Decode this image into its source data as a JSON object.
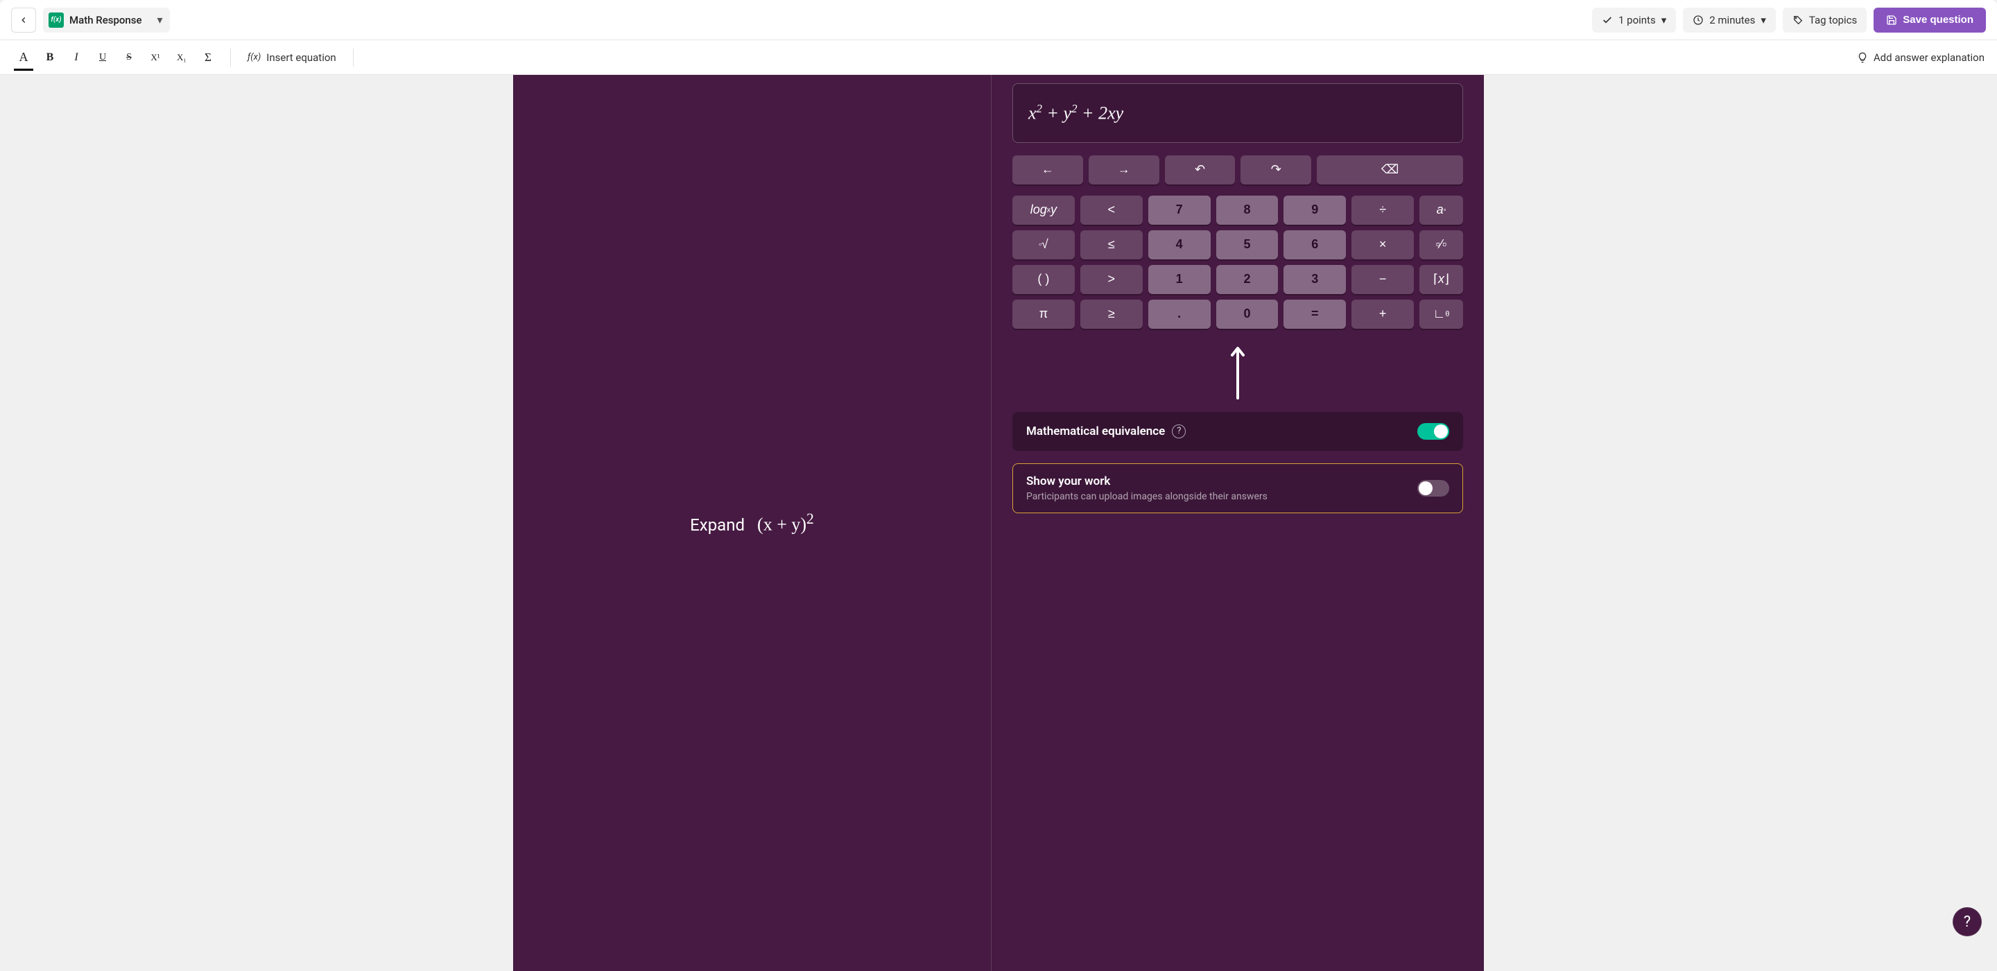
{
  "header": {
    "type_label": "Math Response",
    "fx_badge": "f(x)",
    "points": "1 points",
    "minutes": "2 minutes",
    "tag_topics": "Tag topics",
    "save": "Save question"
  },
  "format": {
    "color": "A",
    "bold": "B",
    "italic": "I",
    "underline": "U",
    "strike": "S",
    "super": "X¹",
    "sub": "X₁",
    "sigma": "Σ",
    "insert_eq_fx": "ƒ(x)",
    "insert_eq": "Insert equation",
    "add_explanation": "Add answer explanation"
  },
  "question": {
    "prompt_word": "Expand",
    "prompt_math_html": "(x + y)<sup>2</sup>"
  },
  "answer": {
    "expr_html": "x<sup>2</sup> + y<sup>2</sup> + 2xy"
  },
  "keypad": {
    "nav": {
      "left": "←",
      "right": "→",
      "undo": "↶",
      "redo": "↷",
      "bksp": "⌫"
    },
    "rows": [
      [
        {
          "t": "op",
          "html": "<i>log</i><sub>x</sub><i>y</i>"
        },
        {
          "t": "op",
          "label": "<"
        },
        {
          "t": "num",
          "label": "7"
        },
        {
          "t": "num",
          "label": "8"
        },
        {
          "t": "num",
          "label": "9"
        },
        {
          "t": "op",
          "label": "÷"
        },
        {
          "t": "tiny",
          "html": "<i>a</i><sup>▫</sup>"
        }
      ],
      [
        {
          "t": "op",
          "html": "<sup>▫</sup>√"
        },
        {
          "t": "op",
          "label": "≤"
        },
        {
          "t": "num",
          "label": "4"
        },
        {
          "t": "num",
          "label": "5"
        },
        {
          "t": "num",
          "label": "6"
        },
        {
          "t": "op",
          "label": "×"
        },
        {
          "t": "tiny",
          "html": "▫⁄▫"
        }
      ],
      [
        {
          "t": "op",
          "label": "( )"
        },
        {
          "t": "op",
          "label": ">"
        },
        {
          "t": "num",
          "label": "1"
        },
        {
          "t": "num",
          "label": "2"
        },
        {
          "t": "num",
          "label": "3"
        },
        {
          "t": "op",
          "label": "−"
        },
        {
          "t": "tiny",
          "html": "⌈<i>x</i>⌋"
        }
      ],
      [
        {
          "t": "op",
          "label": "π"
        },
        {
          "t": "op",
          "label": "≥"
        },
        {
          "t": "num",
          "label": "."
        },
        {
          "t": "num",
          "label": "0"
        },
        {
          "t": "num",
          "label": "="
        },
        {
          "t": "op",
          "label": "+"
        },
        {
          "t": "tiny",
          "html": "∟<sup>θ</sup>"
        }
      ]
    ]
  },
  "options": {
    "math_equiv": {
      "label": "Mathematical equivalence",
      "on": true
    },
    "show_work": {
      "label": "Show your work",
      "desc": "Participants can upload images alongside their answers",
      "on": false
    }
  },
  "help_fab": "?"
}
